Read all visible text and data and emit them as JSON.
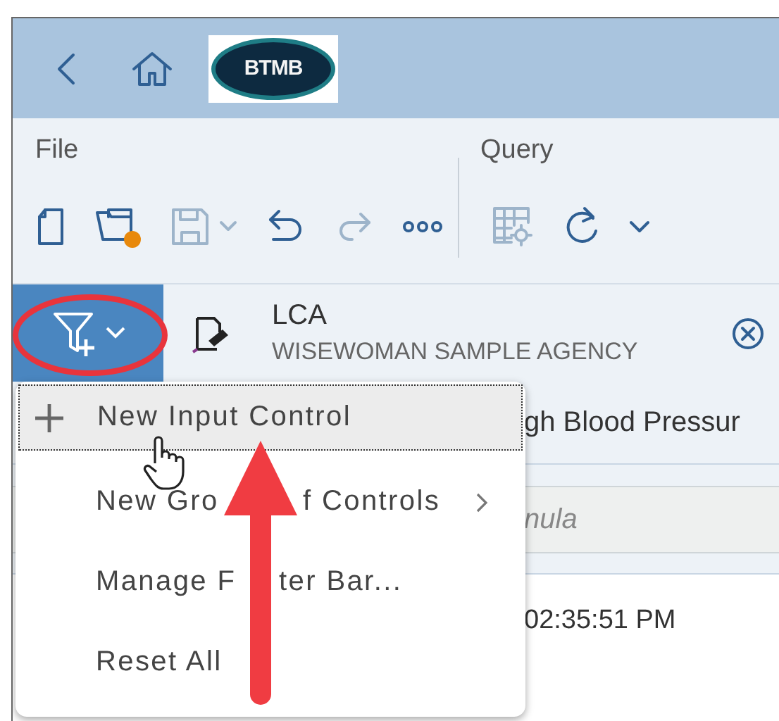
{
  "app_bar": {
    "logo_text": "BTMB"
  },
  "menu_groups": [
    {
      "label": "File"
    },
    {
      "label": "Query"
    }
  ],
  "toolbar": [
    {
      "kind": "new",
      "disabled": false
    },
    {
      "kind": "open",
      "disabled": false
    },
    {
      "kind": "save",
      "disabled": true
    },
    {
      "kind": "undo",
      "disabled": false
    },
    {
      "kind": "redo",
      "disabled": true
    },
    {
      "kind": "more",
      "disabled": false
    },
    {
      "kind": "query-settings",
      "disabled": true
    },
    {
      "kind": "refresh",
      "disabled": false
    },
    {
      "kind": "dropdown",
      "disabled": false
    }
  ],
  "filter_bar": {
    "name": "LCA",
    "subtitle": "WISEWOMAN SAMPLE AGENCY"
  },
  "content": {
    "row_text": "gh Blood Pressur",
    "field_placeholder": "nula",
    "timestamp": "02:35:51 PM"
  },
  "menu": [
    {
      "label_parts": [
        "New Input Control"
      ],
      "kind": "add",
      "focused": true,
      "submenu": false
    },
    {
      "label_parts": [
        "New Gro",
        "f Controls"
      ],
      "kind": "plain",
      "focused": false,
      "submenu": true
    },
    {
      "label_parts": [
        "Manage F",
        "ter Bar..."
      ],
      "kind": "plain",
      "focused": false,
      "submenu": false
    },
    {
      "label_parts": [
        "Reset All"
      ],
      "kind": "plain",
      "focused": false,
      "submenu": false
    }
  ]
}
